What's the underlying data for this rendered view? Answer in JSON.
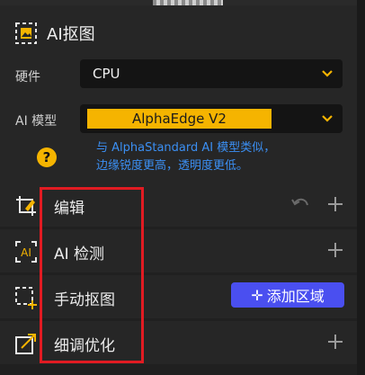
{
  "panel": {
    "title": "AI抠图",
    "hardware": {
      "label": "硬件",
      "value": "CPU"
    },
    "model": {
      "label": "AI 模型",
      "value": "AlphaEdge  V2"
    },
    "description_line1": "与 AlphaStandard AI 模型类似，",
    "description_line2": "边缘锐度更高，透明度更低。",
    "help_symbol": "?"
  },
  "sections": [
    {
      "title": "编辑"
    },
    {
      "title": "AI 检测"
    },
    {
      "title": "手动抠图",
      "button": "添加区域"
    },
    {
      "title": "细调优化"
    }
  ],
  "colors": {
    "accent_yellow": "#f5b400",
    "link_blue": "#3b8ff3",
    "button_blue": "#4a4ff0",
    "highlight_red": "#e11b22"
  }
}
